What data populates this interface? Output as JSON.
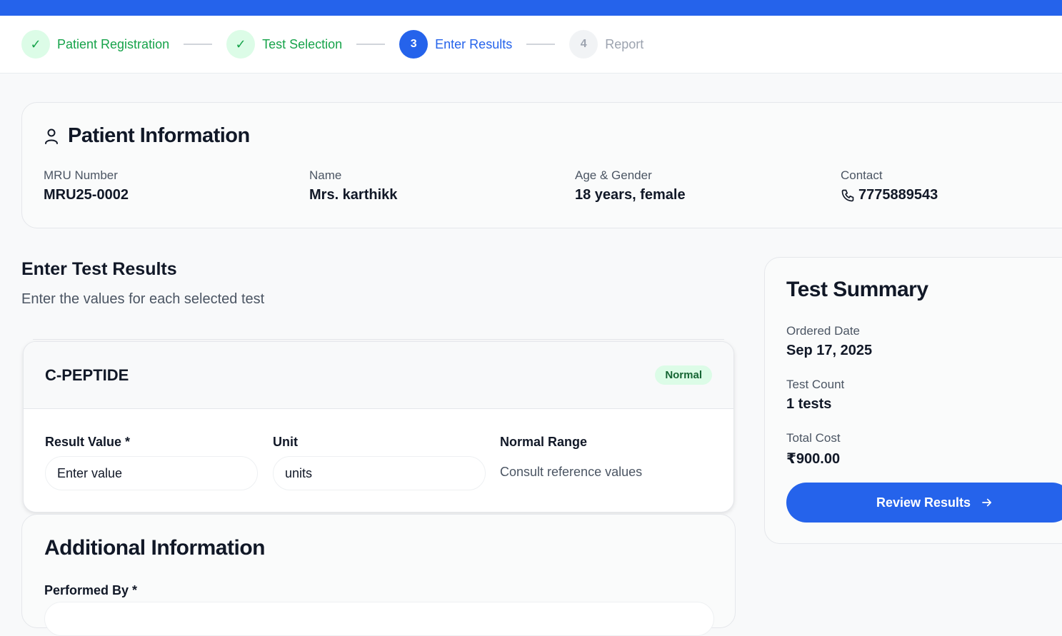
{
  "stepper": {
    "steps": [
      {
        "number": "✓",
        "label": "Patient Registration",
        "state": "done"
      },
      {
        "number": "✓",
        "label": "Test Selection",
        "state": "done"
      },
      {
        "number": "3",
        "label": "Enter Results",
        "state": "active"
      },
      {
        "number": "4",
        "label": "Report",
        "state": "pending"
      }
    ]
  },
  "patient": {
    "title": "Patient Information",
    "fields": [
      {
        "label": "MRU Number",
        "value": "MRU25-0002"
      },
      {
        "label": "Name",
        "value": "Mrs. karthikk"
      },
      {
        "label": "Age & Gender",
        "value": "18 years, female"
      },
      {
        "label": "Contact",
        "value": "7775889543"
      }
    ]
  },
  "results": {
    "title": "Enter Test Results",
    "subtitle": "Enter the values for each selected test",
    "test": {
      "name": "C-PEPTIDE",
      "status_badge": "Normal",
      "result_label": "Result Value *",
      "result_placeholder": "Enter value",
      "unit_label": "Unit",
      "unit_value": "units",
      "range_label": "Normal Range",
      "range_value": "Consult reference values"
    }
  },
  "additional": {
    "title": "Additional Information",
    "performed_by_label": "Performed By *"
  },
  "summary": {
    "title": "Test Summary",
    "ordered_date_label": "Ordered Date",
    "ordered_date": "Sep 17, 2025",
    "test_count_label": "Test Count",
    "test_count": "1 tests",
    "total_cost_label": "Total Cost",
    "total_cost": "₹900.00",
    "review_button": "Review Results"
  },
  "colors": {
    "primary": "#2563eb",
    "success": "#16a34a",
    "success_bg": "#dcfce7",
    "muted": "#9ca3af"
  }
}
